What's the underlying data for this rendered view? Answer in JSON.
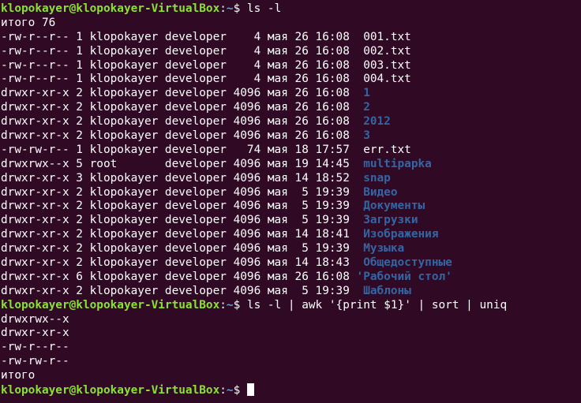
{
  "colors": {
    "background": "#300a24",
    "prompt_user": "#8ae234",
    "prompt_path": "#729fcf",
    "text": "#ffffff",
    "directory": "#3465a4"
  },
  "prompt": {
    "user_host": "klopokayer@klopokayer-VirtualBox",
    "separator": ":",
    "path": "~",
    "symbol": "$ "
  },
  "commands": [
    "ls -l",
    "ls -l | awk '{print $1}' | sort | uniq"
  ],
  "ls_total": "итого 76",
  "ls_rows": [
    {
      "meta": "-rw-r--r-- 1 klopokayer developer    4 мая 26 16:08  ",
      "name": "001.txt",
      "is_dir": false
    },
    {
      "meta": "-rw-r--r-- 1 klopokayer developer    4 мая 26 16:08  ",
      "name": "002.txt",
      "is_dir": false
    },
    {
      "meta": "-rw-r--r-- 1 klopokayer developer    4 мая 26 16:08  ",
      "name": "003.txt",
      "is_dir": false
    },
    {
      "meta": "-rw-r--r-- 1 klopokayer developer    4 мая 26 16:08  ",
      "name": "004.txt",
      "is_dir": false
    },
    {
      "meta": "drwxr-xr-x 2 klopokayer developer 4096 мая 26 16:08  ",
      "name": "1",
      "is_dir": true
    },
    {
      "meta": "drwxr-xr-x 2 klopokayer developer 4096 мая 26 16:08  ",
      "name": "2",
      "is_dir": true
    },
    {
      "meta": "drwxr-xr-x 2 klopokayer developer 4096 мая 26 16:08  ",
      "name": "2012",
      "is_dir": true
    },
    {
      "meta": "drwxr-xr-x 2 klopokayer developer 4096 мая 26 16:08  ",
      "name": "3",
      "is_dir": true
    },
    {
      "meta": "-rw-rw-r-- 1 klopokayer developer   74 мая 18 17:57  ",
      "name": "err.txt",
      "is_dir": false
    },
    {
      "meta": "drwxrwx--x 5 root       developer 4096 мая 19 14:45  ",
      "name": "multipapka",
      "is_dir": true
    },
    {
      "meta": "drwxr-xr-x 3 klopokayer developer 4096 мая 14 18:52  ",
      "name": "snap",
      "is_dir": true
    },
    {
      "meta": "drwxr-xr-x 2 klopokayer developer 4096 мая  5 19:39  ",
      "name": "Видео",
      "is_dir": true
    },
    {
      "meta": "drwxr-xr-x 2 klopokayer developer 4096 мая  5 19:39  ",
      "name": "Документы",
      "is_dir": true
    },
    {
      "meta": "drwxr-xr-x 2 klopokayer developer 4096 мая  5 19:39  ",
      "name": "Загрузки",
      "is_dir": true
    },
    {
      "meta": "drwxr-xr-x 2 klopokayer developer 4096 мая 14 18:41  ",
      "name": "Изображения",
      "is_dir": true
    },
    {
      "meta": "drwxr-xr-x 2 klopokayer developer 4096 мая  5 19:39  ",
      "name": "Музыка",
      "is_dir": true
    },
    {
      "meta": "drwxr-xr-x 2 klopokayer developer 4096 мая 14 18:43  ",
      "name": "Общедоступные",
      "is_dir": true
    },
    {
      "meta": "drwxr-xr-x 6 klopokayer developer 4096 мая 26 16:08 ",
      "name": "'Рабочий стол'",
      "is_dir": true
    },
    {
      "meta": "drwxr-xr-x 2 klopokayer developer 4096 мая  5 19:39  ",
      "name": "Шаблоны",
      "is_dir": true
    }
  ],
  "uniq_output": [
    "drwxrwx--x",
    "drwxr-xr-x",
    "-rw-r--r--",
    "-rw-rw-r--",
    "итого"
  ]
}
